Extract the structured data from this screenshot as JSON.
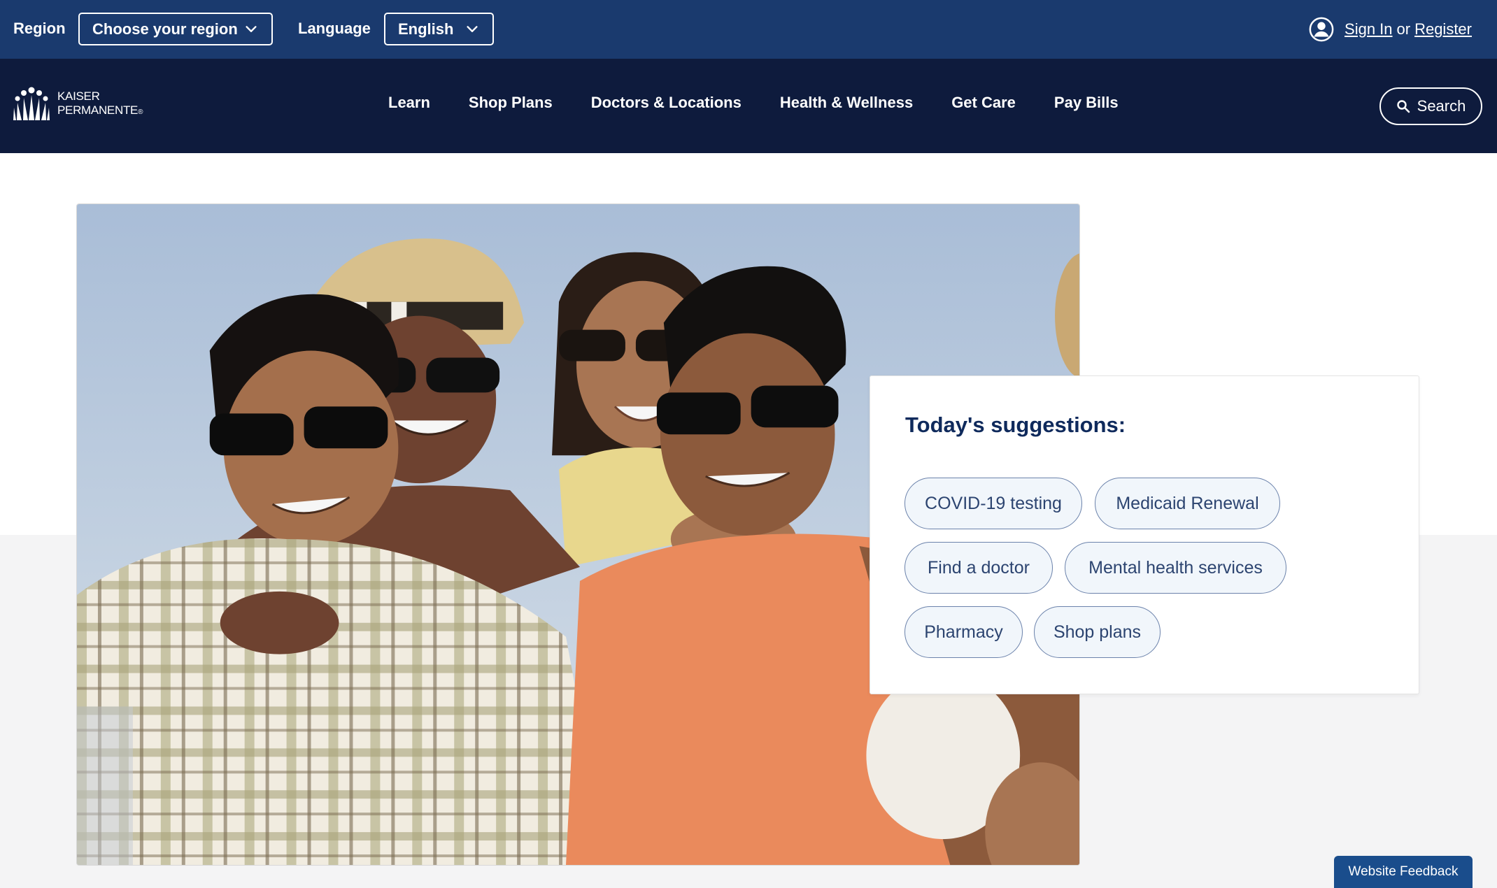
{
  "utility_bar": {
    "region_label": "Region",
    "region_select": "Choose your region",
    "language_label": "Language",
    "language_select": "English",
    "sign_in": "Sign In",
    "or_text": "or",
    "register": "Register"
  },
  "header": {
    "logo_line1": "KAISER",
    "logo_line2": "PERMANENTE",
    "logo_mark": "®",
    "nav": [
      "Learn",
      "Shop Plans",
      "Doctors & Locations",
      "Health & Wellness",
      "Get Care",
      "Pay Bills"
    ],
    "search_label": "Search"
  },
  "hero": {
    "image": "photo of four smiling friends wearing sunglasses at the beach"
  },
  "suggestions": {
    "title": "Today's suggestions:",
    "chips": [
      "COVID-19 testing",
      "Medicaid Renewal",
      "Find a doctor",
      "Mental health services",
      "Pharmacy",
      "Shop plans"
    ]
  },
  "feedback_label": "Website Feedback",
  "colors": {
    "utility_bg": "#1a3a6e",
    "nav_bg": "#0e1b3d",
    "chip_border": "#6b82ab",
    "chip_bg": "#f1f6fb",
    "title_color": "#0f2a5c",
    "feedback_bg": "#1a4d8c"
  },
  "icons": {
    "account": "user-circle-icon",
    "search": "magnifier-icon",
    "dropdown": "chevron-down-icon",
    "logo": "kp-people-logo-icon"
  }
}
